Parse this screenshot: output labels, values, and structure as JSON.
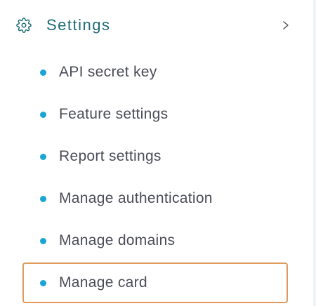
{
  "sidebar": {
    "settings": {
      "title": "Settings",
      "icon": "gear-icon",
      "expand_icon": "chevron-right-icon",
      "title_color": "#1e6b76"
    },
    "items": [
      {
        "label": "API secret key",
        "active": false
      },
      {
        "label": "Feature settings",
        "active": false
      },
      {
        "label": "Report settings",
        "active": false
      },
      {
        "label": "Manage authentication",
        "active": false
      },
      {
        "label": "Manage domains",
        "active": false
      },
      {
        "label": "Manage card",
        "active": true
      }
    ],
    "bullet_color": "#1aa6d4",
    "active_border_color": "#e09a5e"
  }
}
